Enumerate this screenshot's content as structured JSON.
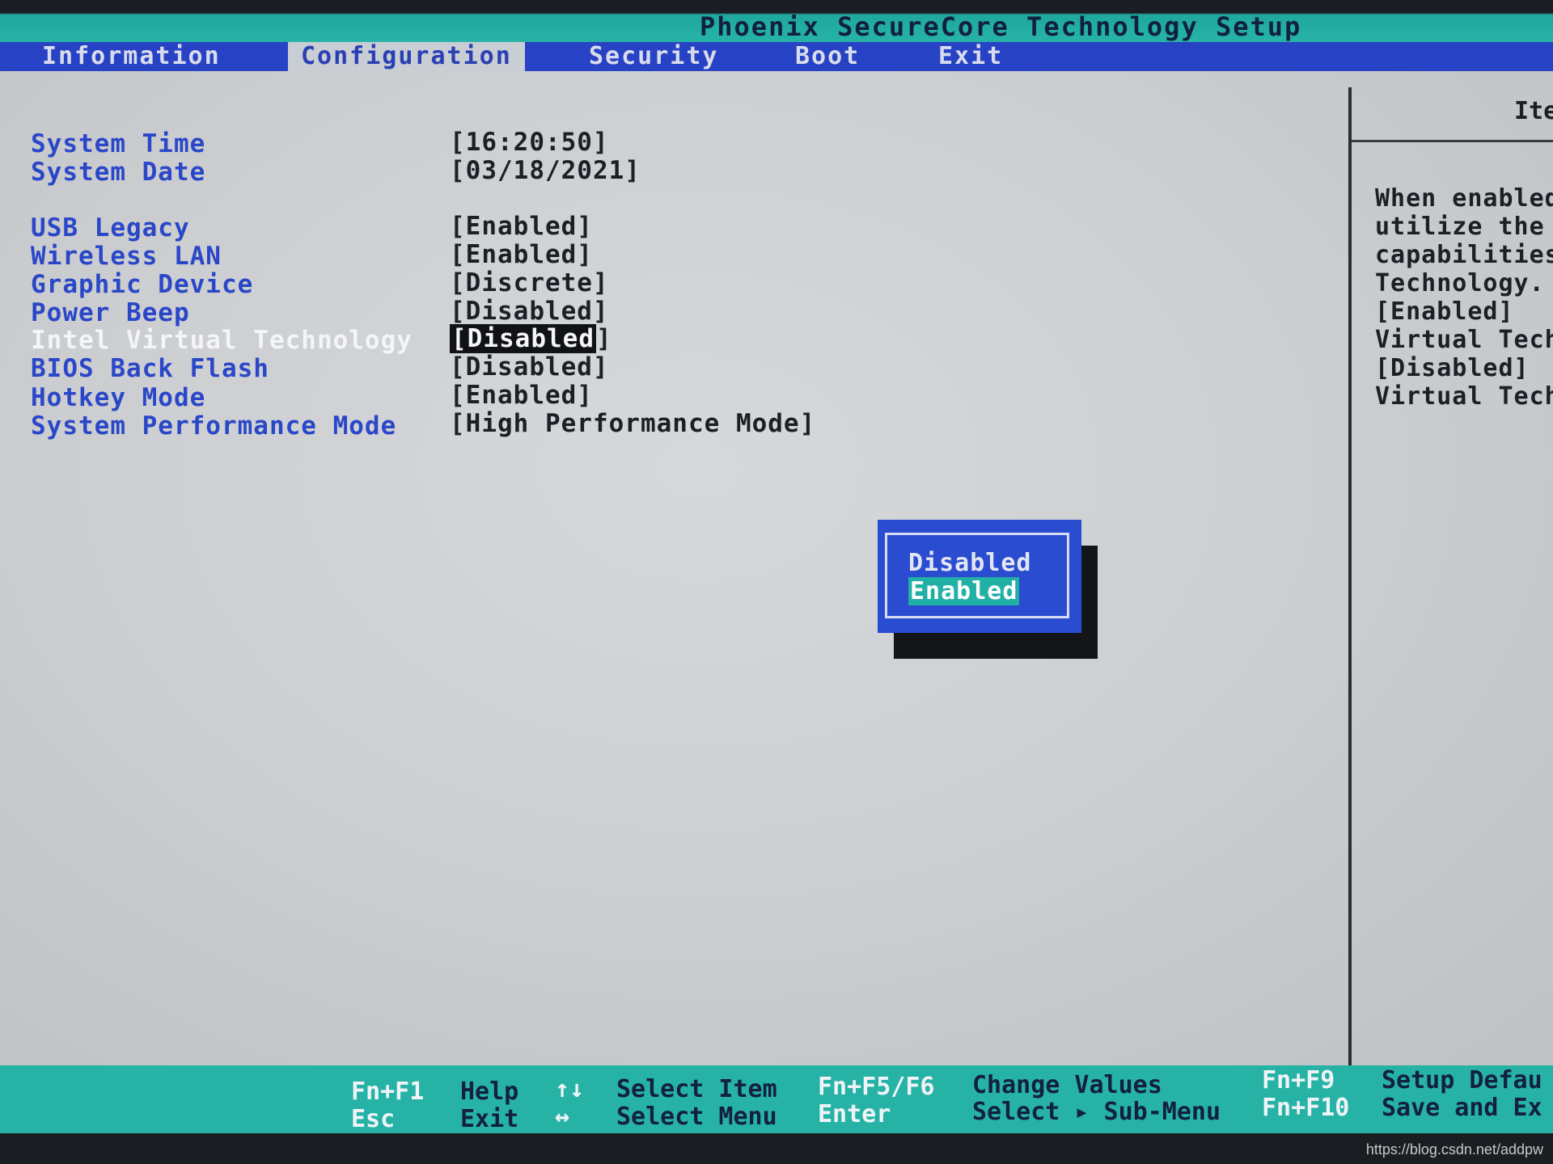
{
  "title": "Phoenix SecureCore Technology Setup",
  "menu": [
    {
      "label": "Information"
    },
    {
      "label": "Configuration"
    },
    {
      "label": "Security"
    },
    {
      "label": "Boot"
    },
    {
      "label": "Exit"
    }
  ],
  "settings": [
    {
      "label": "System Time",
      "value": "[16:20:50]"
    },
    {
      "label": "System Date",
      "value": "[03/18/2021]"
    },
    {
      "label": "USB Legacy",
      "value": "[Enabled]"
    },
    {
      "label": "Wireless LAN",
      "value": "[Enabled]"
    },
    {
      "label": "Graphic Device",
      "value": "[Discrete]"
    },
    {
      "label": "Power Beep",
      "value": "[Disabled]"
    },
    {
      "label": "Intel Virtual Technology",
      "value_open": "[",
      "value_text": "Disabled",
      "value_close": "]"
    },
    {
      "label": "BIOS Back Flash",
      "value": "[Disabled]"
    },
    {
      "label": "Hotkey Mode",
      "value": "[Enabled]"
    },
    {
      "label": "System Performance Mode",
      "value": "[High Performance Mode]"
    }
  ],
  "help": {
    "title": "Ite",
    "lines": [
      "When enabled",
      "utilize the",
      "capabilities",
      "Technology.",
      "[Enabled]",
      "Virtual Tech",
      "[Disabled]",
      "Virtual Tech"
    ]
  },
  "popup": {
    "options": [
      "Disabled",
      "Enabled"
    ]
  },
  "footer": {
    "fn_f1": "Fn+F1",
    "help": "Help",
    "updown": "↑↓",
    "select_item": "Select Item",
    "fn_f5f6": "Fn+F5/F6",
    "change_values": "Change Values",
    "fn_f9": "Fn+F9",
    "setup_defaults": "Setup Defau",
    "esc": "Esc",
    "exit": "Exit",
    "leftright": "↔",
    "select_menu": "Select Menu",
    "enter": "Enter",
    "select_submenu": "Select ▸ Sub-Menu",
    "fn_f10": "Fn+F10",
    "save_exit": "Save and Ex"
  },
  "watermark": "https://blog.csdn.net/addpw",
  "colors": {
    "menu_bar": "#2742c4",
    "footer": "#26b3a6",
    "label_blue": "#2a47c8",
    "screen_bg": "#cdcfd2"
  }
}
